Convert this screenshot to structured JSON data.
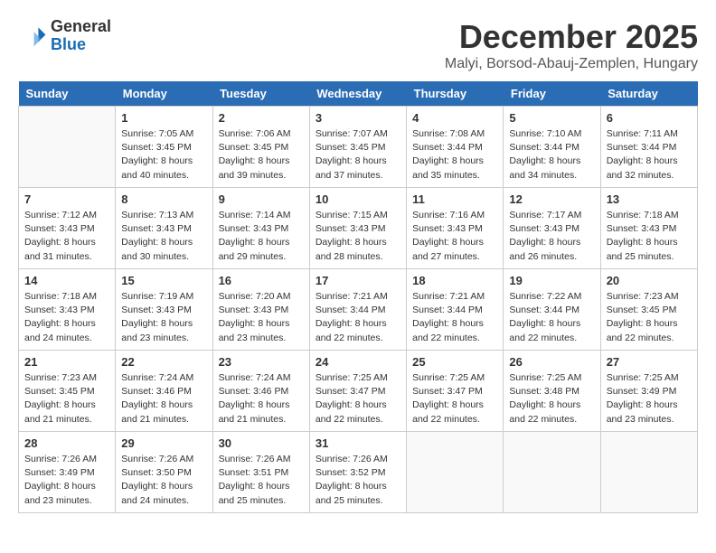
{
  "header": {
    "logo_general": "General",
    "logo_blue": "Blue",
    "month_title": "December 2025",
    "location": "Malyi, Borsod-Abauj-Zemplen, Hungary"
  },
  "days_of_week": [
    "Sunday",
    "Monday",
    "Tuesday",
    "Wednesday",
    "Thursday",
    "Friday",
    "Saturday"
  ],
  "weeks": [
    [
      {
        "day": "",
        "info": ""
      },
      {
        "day": "1",
        "info": "Sunrise: 7:05 AM\nSunset: 3:45 PM\nDaylight: 8 hours\nand 40 minutes."
      },
      {
        "day": "2",
        "info": "Sunrise: 7:06 AM\nSunset: 3:45 PM\nDaylight: 8 hours\nand 39 minutes."
      },
      {
        "day": "3",
        "info": "Sunrise: 7:07 AM\nSunset: 3:45 PM\nDaylight: 8 hours\nand 37 minutes."
      },
      {
        "day": "4",
        "info": "Sunrise: 7:08 AM\nSunset: 3:44 PM\nDaylight: 8 hours\nand 35 minutes."
      },
      {
        "day": "5",
        "info": "Sunrise: 7:10 AM\nSunset: 3:44 PM\nDaylight: 8 hours\nand 34 minutes."
      },
      {
        "day": "6",
        "info": "Sunrise: 7:11 AM\nSunset: 3:44 PM\nDaylight: 8 hours\nand 32 minutes."
      }
    ],
    [
      {
        "day": "7",
        "info": "Sunrise: 7:12 AM\nSunset: 3:43 PM\nDaylight: 8 hours\nand 31 minutes."
      },
      {
        "day": "8",
        "info": "Sunrise: 7:13 AM\nSunset: 3:43 PM\nDaylight: 8 hours\nand 30 minutes."
      },
      {
        "day": "9",
        "info": "Sunrise: 7:14 AM\nSunset: 3:43 PM\nDaylight: 8 hours\nand 29 minutes."
      },
      {
        "day": "10",
        "info": "Sunrise: 7:15 AM\nSunset: 3:43 PM\nDaylight: 8 hours\nand 28 minutes."
      },
      {
        "day": "11",
        "info": "Sunrise: 7:16 AM\nSunset: 3:43 PM\nDaylight: 8 hours\nand 27 minutes."
      },
      {
        "day": "12",
        "info": "Sunrise: 7:17 AM\nSunset: 3:43 PM\nDaylight: 8 hours\nand 26 minutes."
      },
      {
        "day": "13",
        "info": "Sunrise: 7:18 AM\nSunset: 3:43 PM\nDaylight: 8 hours\nand 25 minutes."
      }
    ],
    [
      {
        "day": "14",
        "info": "Sunrise: 7:18 AM\nSunset: 3:43 PM\nDaylight: 8 hours\nand 24 minutes."
      },
      {
        "day": "15",
        "info": "Sunrise: 7:19 AM\nSunset: 3:43 PM\nDaylight: 8 hours\nand 23 minutes."
      },
      {
        "day": "16",
        "info": "Sunrise: 7:20 AM\nSunset: 3:43 PM\nDaylight: 8 hours\nand 23 minutes."
      },
      {
        "day": "17",
        "info": "Sunrise: 7:21 AM\nSunset: 3:44 PM\nDaylight: 8 hours\nand 22 minutes."
      },
      {
        "day": "18",
        "info": "Sunrise: 7:21 AM\nSunset: 3:44 PM\nDaylight: 8 hours\nand 22 minutes."
      },
      {
        "day": "19",
        "info": "Sunrise: 7:22 AM\nSunset: 3:44 PM\nDaylight: 8 hours\nand 22 minutes."
      },
      {
        "day": "20",
        "info": "Sunrise: 7:23 AM\nSunset: 3:45 PM\nDaylight: 8 hours\nand 22 minutes."
      }
    ],
    [
      {
        "day": "21",
        "info": "Sunrise: 7:23 AM\nSunset: 3:45 PM\nDaylight: 8 hours\nand 21 minutes."
      },
      {
        "day": "22",
        "info": "Sunrise: 7:24 AM\nSunset: 3:46 PM\nDaylight: 8 hours\nand 21 minutes."
      },
      {
        "day": "23",
        "info": "Sunrise: 7:24 AM\nSunset: 3:46 PM\nDaylight: 8 hours\nand 21 minutes."
      },
      {
        "day": "24",
        "info": "Sunrise: 7:25 AM\nSunset: 3:47 PM\nDaylight: 8 hours\nand 22 minutes."
      },
      {
        "day": "25",
        "info": "Sunrise: 7:25 AM\nSunset: 3:47 PM\nDaylight: 8 hours\nand 22 minutes."
      },
      {
        "day": "26",
        "info": "Sunrise: 7:25 AM\nSunset: 3:48 PM\nDaylight: 8 hours\nand 22 minutes."
      },
      {
        "day": "27",
        "info": "Sunrise: 7:25 AM\nSunset: 3:49 PM\nDaylight: 8 hours\nand 23 minutes."
      }
    ],
    [
      {
        "day": "28",
        "info": "Sunrise: 7:26 AM\nSunset: 3:49 PM\nDaylight: 8 hours\nand 23 minutes."
      },
      {
        "day": "29",
        "info": "Sunrise: 7:26 AM\nSunset: 3:50 PM\nDaylight: 8 hours\nand 24 minutes."
      },
      {
        "day": "30",
        "info": "Sunrise: 7:26 AM\nSunset: 3:51 PM\nDaylight: 8 hours\nand 25 minutes."
      },
      {
        "day": "31",
        "info": "Sunrise: 7:26 AM\nSunset: 3:52 PM\nDaylight: 8 hours\nand 25 minutes."
      },
      {
        "day": "",
        "info": ""
      },
      {
        "day": "",
        "info": ""
      },
      {
        "day": "",
        "info": ""
      }
    ]
  ]
}
